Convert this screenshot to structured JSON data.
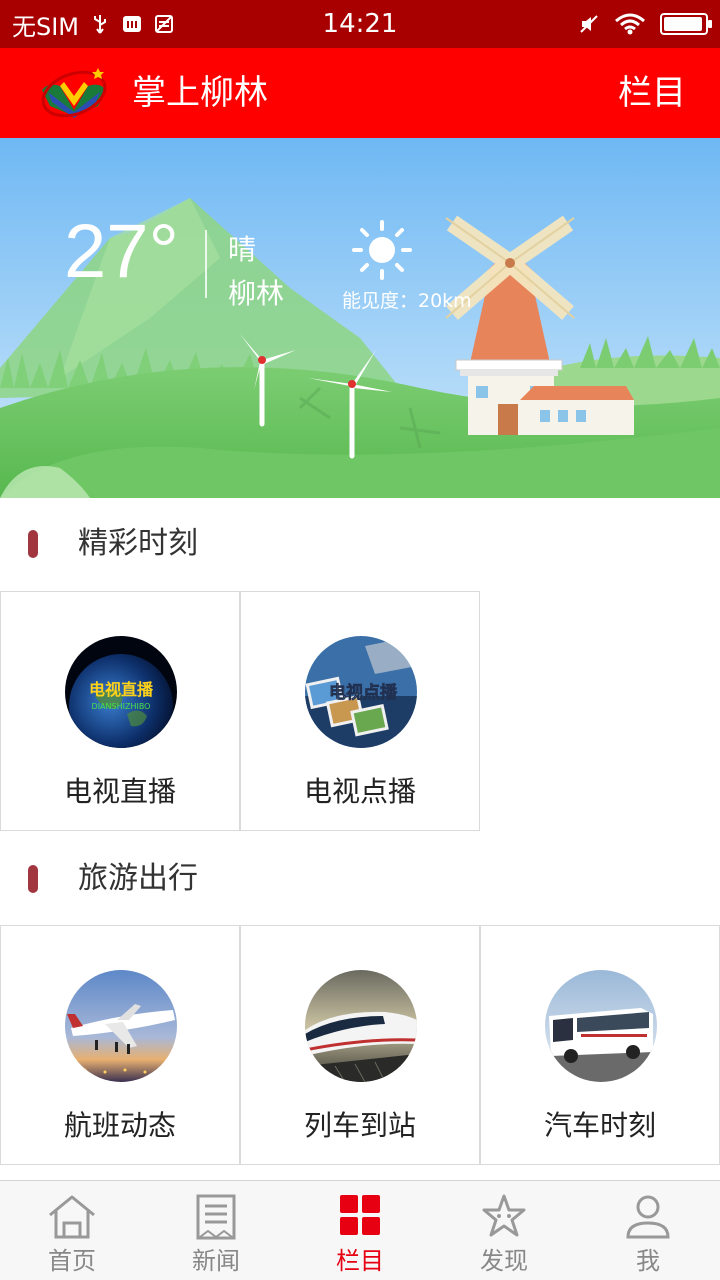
{
  "status_bar": {
    "carrier": "无SIM",
    "time": "14:21",
    "battery_level": 0.95
  },
  "header": {
    "title": "掌上柳林",
    "right_label": "栏目"
  },
  "weather": {
    "temperature": "27°",
    "condition": "晴",
    "city": "柳林",
    "visibility": "能见度：20km"
  },
  "sections": [
    {
      "title": "精彩时刻",
      "items": [
        {
          "label": "电视直播",
          "thumb_text": "电视直播",
          "thumb_subtext": "DIANSHIZHIBO"
        },
        {
          "label": "电视点播",
          "thumb_text": "电视点播"
        }
      ]
    },
    {
      "title": "旅游出行",
      "items": [
        {
          "label": "航班动态"
        },
        {
          "label": "列车到站"
        },
        {
          "label": "汽车时刻"
        }
      ]
    }
  ],
  "bottom_nav": [
    {
      "label": "首页",
      "icon": "home-icon"
    },
    {
      "label": "新闻",
      "icon": "news-icon"
    },
    {
      "label": "栏目",
      "icon": "grid-icon",
      "active": true
    },
    {
      "label": "发现",
      "icon": "discover-icon"
    },
    {
      "label": "我",
      "icon": "user-icon"
    }
  ],
  "colors": {
    "status_bar": "#a80000",
    "header": "#ff0000",
    "accent": "#e60012",
    "section_mark": "#a2363f"
  }
}
